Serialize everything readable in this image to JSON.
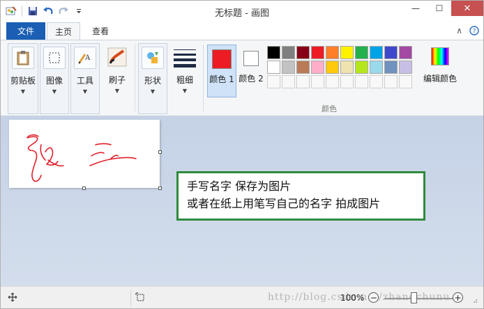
{
  "window": {
    "title": "无标题 - 画图",
    "buttons": {
      "minimize": "—",
      "maximize": "☐",
      "close": "✕"
    }
  },
  "quick_access": {
    "items": [
      "paint-app-icon",
      "save-icon",
      "undo-icon",
      "redo-icon",
      "customize-dropdown"
    ]
  },
  "tabs": {
    "file": "文件",
    "home": "主页",
    "view": "查看",
    "active": "home"
  },
  "ribbon": {
    "groups": [
      {
        "key": "clipboard",
        "label": "剪贴板",
        "icon": "clipboard-icon"
      },
      {
        "key": "image",
        "label": "图像",
        "icon": "select-icon"
      },
      {
        "key": "tools",
        "label": "工具",
        "icon": "tools-icon"
      },
      {
        "key": "brushes",
        "label": "刷子",
        "icon": "brush-icon"
      },
      {
        "key": "shapes",
        "label": "形状",
        "icon": "shapes-icon"
      },
      {
        "key": "size",
        "label": "粗细",
        "icon": "line-size-icon"
      }
    ],
    "color1": {
      "label": "颜色 1",
      "value": "#ed1c24"
    },
    "color2": {
      "label": "颜色 2",
      "value": "#ffffff"
    },
    "edit_colors": "编辑颜色",
    "colors_caption": "颜色",
    "palette": [
      [
        "#000000",
        "#7f7f7f",
        "#880015",
        "#ed1c24",
        "#ff7f27",
        "#fff200",
        "#22b14c",
        "#00a2e8",
        "#3f48cc",
        "#a349a4"
      ],
      [
        "#ffffff",
        "#c3c3c3",
        "#b97a57",
        "#ffaec9",
        "#ffc90e",
        "#efe4b0",
        "#b5e61d",
        "#99d9ea",
        "#7092be",
        "#c8bfe7"
      ],
      [
        "",
        "",
        "",
        "",
        "",
        "",
        "",
        "",
        "",
        ""
      ]
    ]
  },
  "canvas": {
    "drawing": "handwritten-signature",
    "stroke_color": "#e0202a"
  },
  "note": {
    "line1": "手写名字 保存为图片",
    "line2": "或者在纸上用笔写自己的名字 拍成图片",
    "border_color": "#2f8a3c"
  },
  "status": {
    "watermark": "http://blog.csdn.net/zhangchunu",
    "zoom": "100%",
    "zoom_out": "−",
    "zoom_in": "+"
  }
}
